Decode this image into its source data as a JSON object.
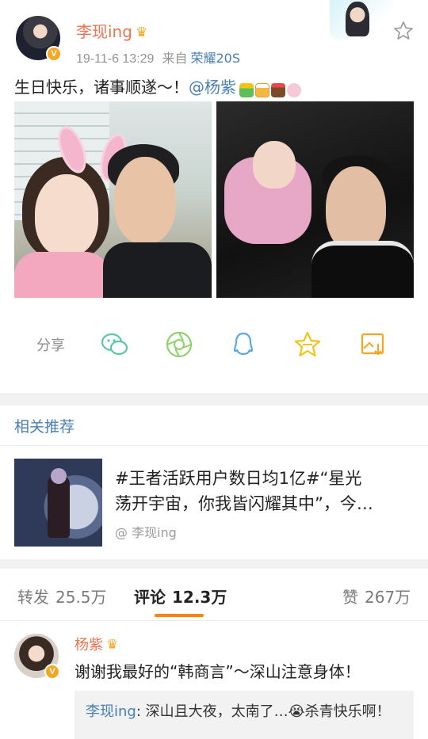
{
  "post": {
    "author": "李现ing",
    "timestamp": "19-11-6 13:29",
    "source_prefix": "来自",
    "device": "荣耀20S",
    "text": "生日快乐，诸事顺遂～！",
    "mention": "@杨紫",
    "emoji": [
      "gift-emoji",
      "beer-emoji",
      "cake-emoji",
      "rabbit-emoji"
    ]
  },
  "share": {
    "label": "分享",
    "icons": [
      "wechat-icon",
      "moments-icon",
      "qq-icon",
      "qzone-icon",
      "save-image-icon"
    ]
  },
  "related": {
    "title": "相关推荐",
    "text_line1": "#王者活跃用户数日均1亿#“星光",
    "text_line2": "荡开宇宙，你我皆闪耀其中”，今…",
    "author": "@ 李现ing"
  },
  "tabs": [
    {
      "label": "转发",
      "count": "25.5万"
    },
    {
      "label": "评论",
      "count": "12.3万"
    },
    {
      "label": "赞",
      "count": "267万"
    }
  ],
  "comment": {
    "author": "杨紫",
    "text": "谢谢我最好的“韩商言”～深山注意身体！",
    "reply_author": "李现ing",
    "reply_text": ": 深山且大夜，太南了…😭杀青快乐啊！"
  },
  "colors": {
    "username": "#eb7350",
    "link": "#4a7fb5",
    "accent": "#ff8200",
    "verified": "#f5a623",
    "share_icon": "#5cc8a0"
  }
}
